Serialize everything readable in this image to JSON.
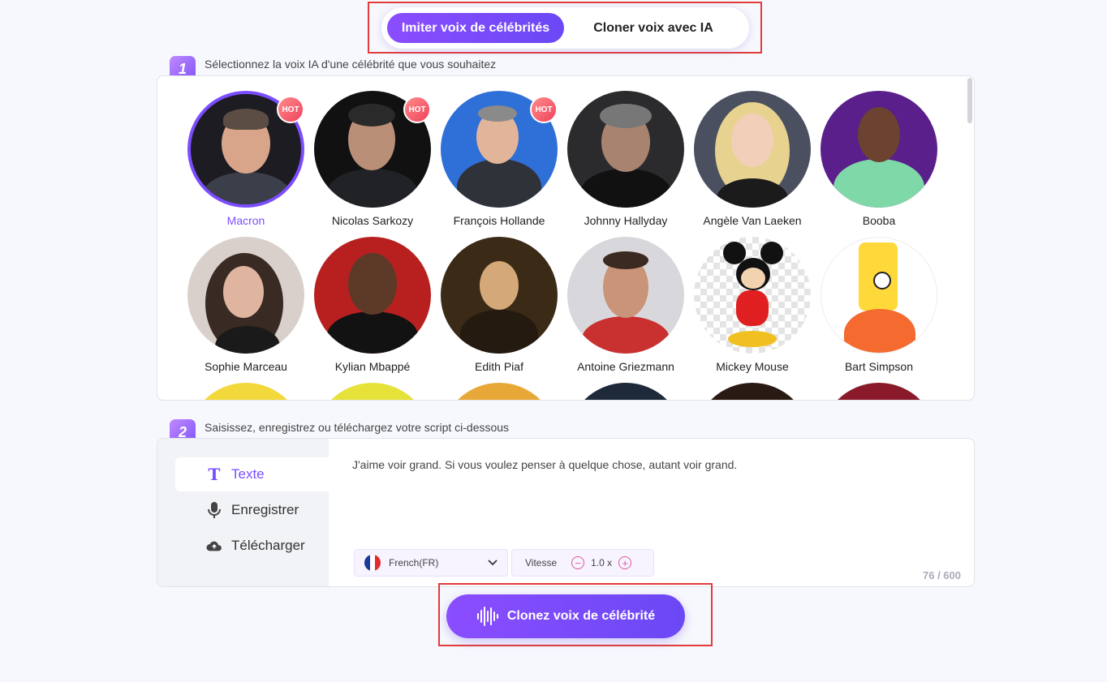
{
  "mode_switch": {
    "active_label": "Imiter voix de célébrités",
    "inactive_label": "Cloner voix avec IA"
  },
  "step1": {
    "number": "1",
    "text": "Sélectionnez la voix IA d'une célébrité que vous souhaitez"
  },
  "step2": {
    "number": "2",
    "text": "Saisissez, enregistrez ou téléchargez votre script ci-dessous"
  },
  "hot_badge": "HOT",
  "celebrities": [
    {
      "name": "Macron",
      "selected": true,
      "hot": true
    },
    {
      "name": "Nicolas Sarkozy",
      "hot": true
    },
    {
      "name": "François Hollande",
      "hot": true
    },
    {
      "name": "Johnny Hallyday"
    },
    {
      "name": "Angèle Van Laeken"
    },
    {
      "name": "Booba"
    },
    {
      "name": "Sophie Marceau"
    },
    {
      "name": "Kylian Mbappé"
    },
    {
      "name": "Edith Piaf"
    },
    {
      "name": "Antoine Griezmann"
    },
    {
      "name": "Mickey Mouse"
    },
    {
      "name": "Bart Simpson"
    }
  ],
  "script_tabs": {
    "text": "Texte",
    "record": "Enregistrer",
    "upload": "Télécharger"
  },
  "script": {
    "content": "J'aime voir grand. Si vous voulez penser à quelque chose, autant voir grand.",
    "counter": "76 / 600"
  },
  "language": {
    "selected": "French(FR)"
  },
  "speed": {
    "label": "Vitesse",
    "value": "1.0 x"
  },
  "clone_button": "Clonez voix de célébrité",
  "colors": {
    "accent": "#7b4dff",
    "highlight_frame": "#e23b3b"
  }
}
